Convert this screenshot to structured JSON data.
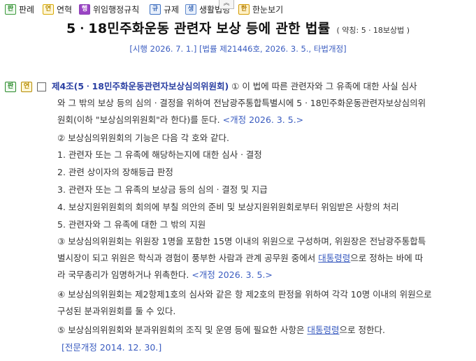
{
  "toolbar": {
    "items": [
      {
        "badge": "판",
        "label": "판례"
      },
      {
        "badge": "연",
        "label": "연혁"
      },
      {
        "badge": "행",
        "label": "위임행정규칙"
      },
      {
        "badge": "규",
        "label": "규제"
      },
      {
        "badge": "생",
        "label": "생활법령"
      },
      {
        "badge": "한",
        "label": "한눈보기"
      }
    ],
    "collapse_glyph": "︽"
  },
  "law": {
    "title": "5ㆍ18민주화운동 관련자 보상 등에 관한 법률",
    "abbreviation": "( 약칭: 5ㆍ18보상법 )",
    "enforcement_info": "[시행 2026. 7. 1.] [법률 제21446호, 2026. 3. 5., 타법개정]"
  },
  "article": {
    "badges": [
      "판",
      "연"
    ],
    "title": "제4조(5ㆍ18민주화운동관련자보상심의위원회)",
    "lines": {
      "l1": "① 이 법에 따른 관련자와 그 유족에 대한 사실 심사",
      "l2": "와 그 밖의 보상 등의 심의ㆍ결정을 위하여 전남광주통합특별시에 5ㆍ18민주화운동관련자보상심의위",
      "l3": "원회(이하 \"보상심의위원회\"라 한다)를 둔다.",
      "l3_amend": "<개정 2026. 3. 5.>",
      "l4": "② 보상심의위원회의 기능은 다음 각 호와 같다.",
      "l5": "1. 관련자 또는 그 유족에 해당하는지에 대한 심사ㆍ결정",
      "l6": "2. 관련 상이자의 장해등급 판정",
      "l7": "3. 관련자 또는 그 유족의 보상금 등의 심의ㆍ결정 및 지급",
      "l8": "4. 보상지원위원회의 회의에 부칠 의안의 준비 및 보상지원위원회로부터 위임받은 사항의 처리",
      "l9": "5. 관련자와 그 유족에 대한 그 밖의 지원",
      "l10": "③ 보상심의위원회는 위원장 1명을 포함한 15명 이내의 위원으로 구성하며, 위원장은 전남광주통합특",
      "l11_pre": "별시장이 되고 위원은 학식과 경험이 풍부한 사람과 관계 공무원 중에서",
      "l11_link": "대통령령",
      "l11_post": "으로 정하는 바에 따",
      "l12": "라 국무총리가 임명하거나 위촉한다.",
      "l12_amend": "<개정 2026. 3. 5.>",
      "l13": "④ 보상심의위원회는 제2항제1호의 심사와 같은 항 제2호의 판정을 위하여 각각 10명 이내의 위원으로",
      "l14": "구성된 분과위원회를 둘 수 있다.",
      "l15_pre": "⑤ 보상심의위원회와 분과위원회의 조직 및 운영 등에 필요한 사항은",
      "l15_link": "대통령령",
      "l15_post": "으로 정한다.",
      "l16": "[전문개정 2014. 12. 30.]"
    }
  }
}
